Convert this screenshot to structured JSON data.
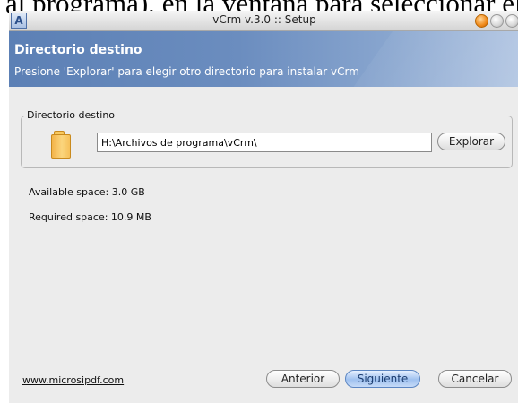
{
  "caption": {
    "text": "al programa), en la ventana para seleccionar el directorio de"
  },
  "window": {
    "title": "vCrm v.3.0 :: Setup",
    "app_icon_glyph": "A"
  },
  "header": {
    "title": "Directorio destino",
    "subtitle": "Presione 'Explorar' para elegir otro directorio para instalar vCrm"
  },
  "directory_group": {
    "legend": "Directorio destino",
    "path_value": "H:\\Archivos de programa\\vCrm\\",
    "explore_label": "Explorar"
  },
  "space": {
    "available": "Available space:  3.0 GB",
    "required": "Required space:  10.9 MB"
  },
  "footer": {
    "link": "www.microsipdf.com",
    "back_label": "Anterior",
    "next_label": "Siguiente",
    "cancel_label": "Cancelar"
  },
  "colors": {
    "header_band": "#6b8dbf",
    "close_button": "#f08a1a",
    "default_button": "#9fc1ef"
  }
}
